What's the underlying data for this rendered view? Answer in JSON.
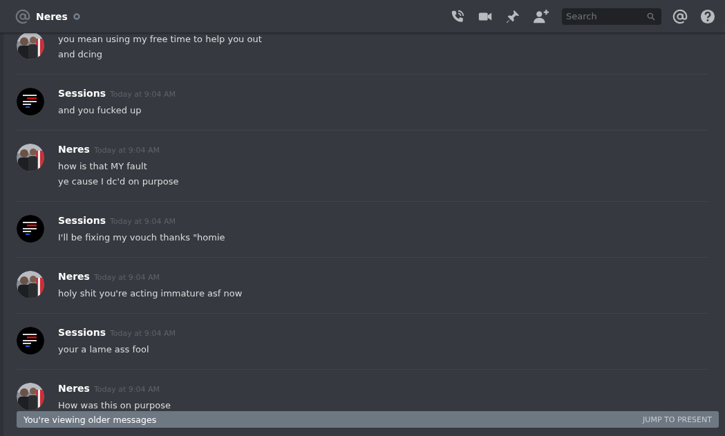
{
  "header": {
    "channel_name": "Neres",
    "search": {
      "placeholder": "Search"
    }
  },
  "messages": [
    {
      "lines": [
        "you mean using my free time to help you out",
        "and dcing"
      ]
    },
    {
      "kind": "dark",
      "author": "Sessions",
      "timestamp": "Today at 9:04 AM",
      "lines": [
        "and you fucked up"
      ]
    },
    {
      "author": "Neres",
      "timestamp": "Today at 9:04 AM",
      "lines": [
        "how is that MY fault",
        "ye cause I dc'd on purpose"
      ]
    },
    {
      "kind": "dark",
      "author": "Sessions",
      "timestamp": "Today at 9:04 AM",
      "lines": [
        "I'll be fixing my vouch thanks \"homie"
      ]
    },
    {
      "author": "Neres",
      "timestamp": "Today at 9:04 AM",
      "lines": [
        "holy shit you're acting immature asf now"
      ]
    },
    {
      "kind": "dark",
      "author": "Sessions",
      "timestamp": "Today at 9:04 AM",
      "lines": [
        "your a lame ass fool"
      ]
    },
    {
      "author": "Neres",
      "timestamp": "Today at 9:04 AM",
      "lines": [
        "How was this on purpose"
      ]
    }
  ],
  "older_banner": {
    "text": "You're viewing older messages",
    "action": "JUMP TO PRESENT"
  }
}
